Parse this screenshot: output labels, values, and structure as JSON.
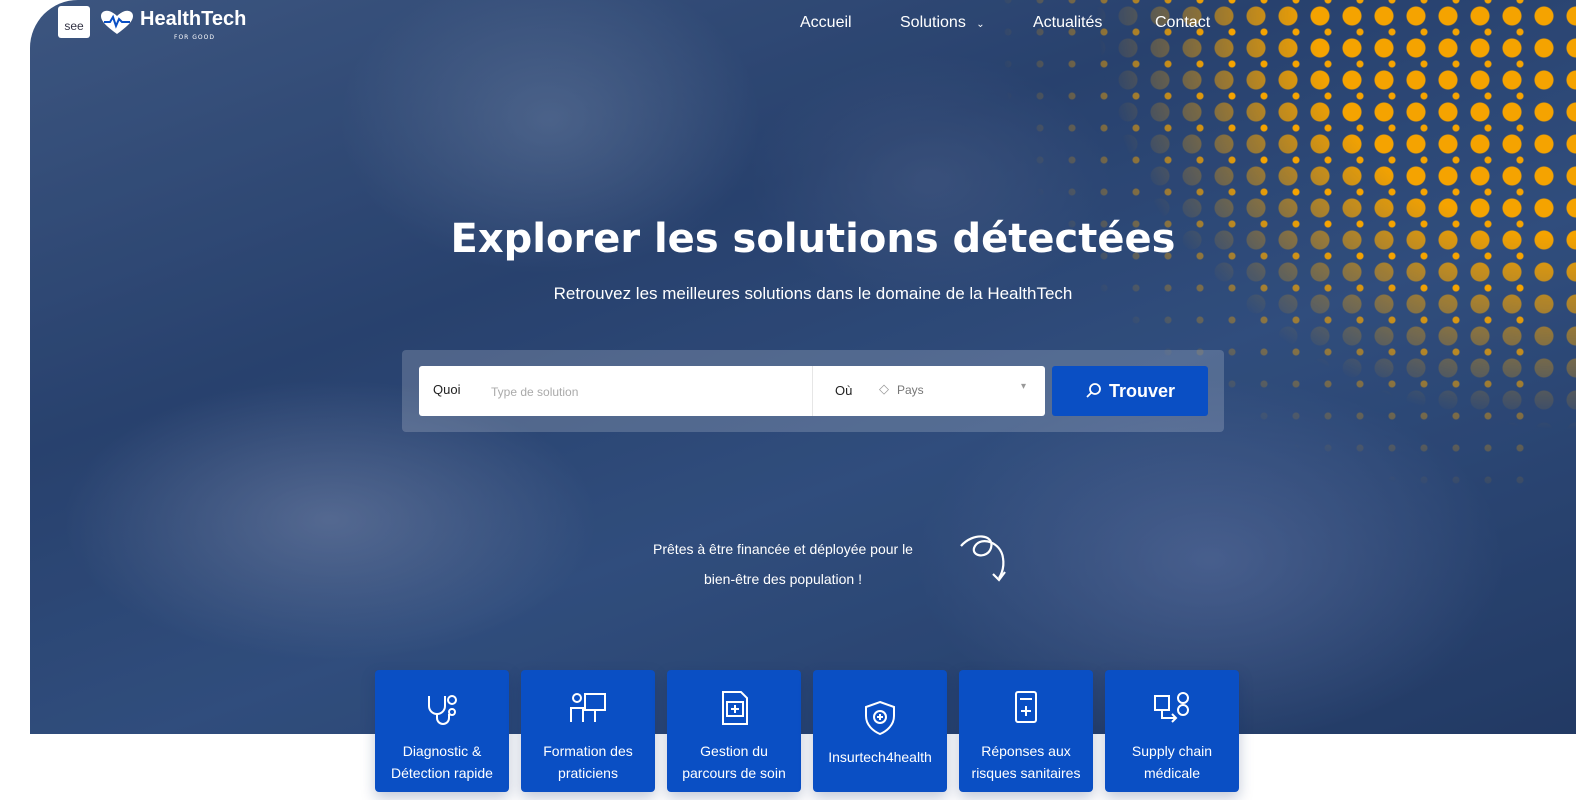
{
  "nav": {
    "logo_see": "see",
    "brand": "HealthTech",
    "brand_sub": "FOR GOOD",
    "links": [
      "Accueil",
      "Solutions",
      "Actualités",
      "Contact"
    ],
    "solutions_chevron": "chevron-down-icon"
  },
  "hero": {
    "title": "Explorer les solutions détectées",
    "subtitle": "Retrouvez les meilleures solutions dans le domaine de la HealthTech",
    "tagline_line1": "Prêtes à être financée et déployée pour le",
    "tagline_line2": "bien-être des population !"
  },
  "search": {
    "quoi_label": "Quoi",
    "quoi_placeholder": "Type de solution",
    "ou_label": "Où",
    "pays_placeholder": "Pays",
    "button_label": "Trouver"
  },
  "categories": [
    {
      "icon": "stethoscope-icon",
      "line1": "Diagnostic &",
      "line2": "Détection rapide"
    },
    {
      "icon": "teacher-board-icon",
      "line1": "Formation des",
      "line2": "praticiens"
    },
    {
      "icon": "medical-file-icon",
      "line1": "Gestion du",
      "line2": "parcours de soin"
    },
    {
      "icon": "shield-plus-icon",
      "line1": "Insurtech4health",
      "line2": ""
    },
    {
      "icon": "medical-form-icon",
      "line1": "Réponses aux",
      "line2": "risques sanitaires"
    },
    {
      "icon": "supply-chain-icon",
      "line1": "Supply chain",
      "line2": "médicale"
    }
  ],
  "colors": {
    "accent_blue": "#0a4fc4",
    "dots_orange": "#f5a300",
    "hero_overlay": "#2f4a78"
  }
}
